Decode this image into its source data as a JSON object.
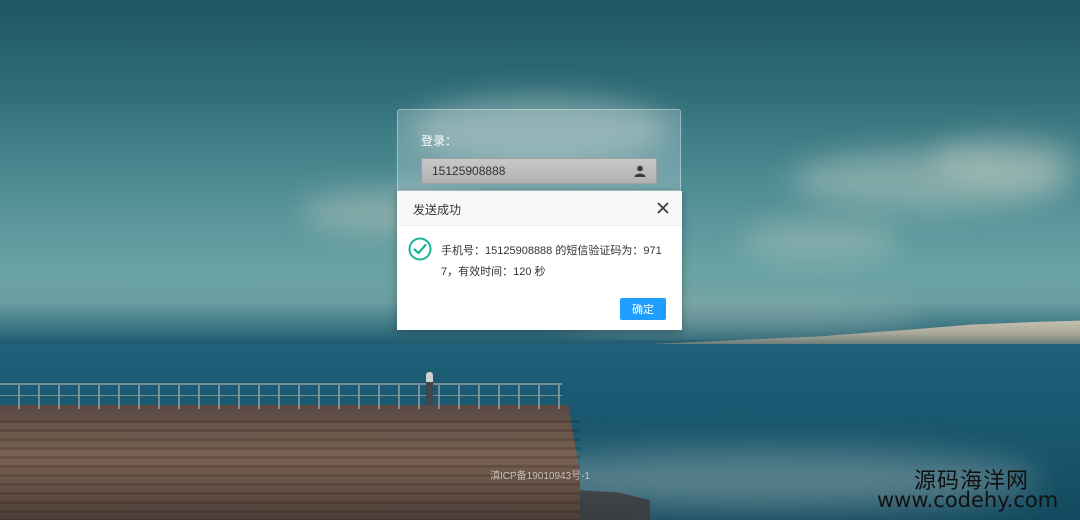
{
  "login": {
    "label": "登录：",
    "phone_value": "15125908888"
  },
  "dialog": {
    "title": "发送成功",
    "message": "手机号：15125908888 的短信验证码为：9717，有效时间：120 秒",
    "confirm_label": "确定"
  },
  "footer": {
    "icp": "滇ICP备19010943号-1"
  },
  "watermark": {
    "cn": "源码海洋网",
    "url": "www.codehy.com"
  },
  "colors": {
    "confirm_button": "#1e9fff",
    "success_icon": "#1ab394"
  },
  "icons": [
    "user-icon",
    "close-icon",
    "success-check-icon"
  ]
}
